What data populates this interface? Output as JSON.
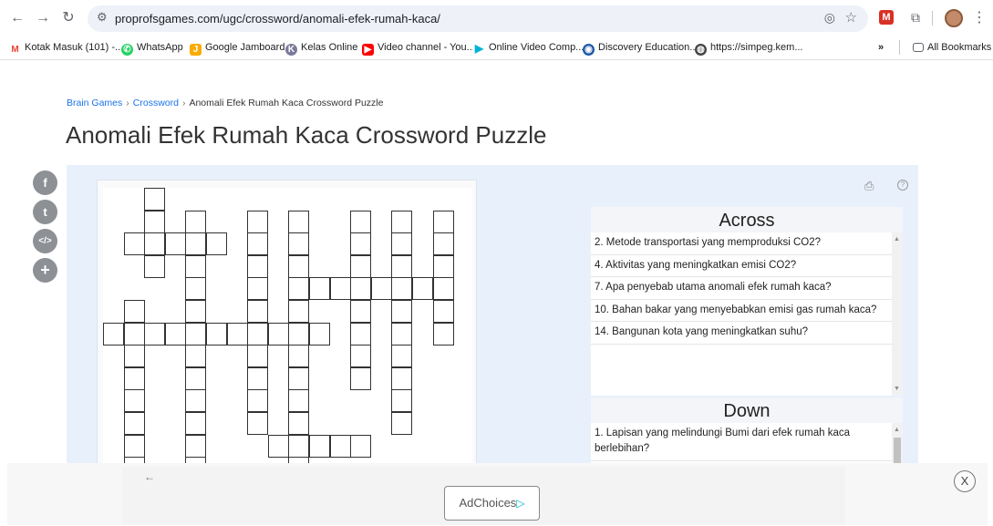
{
  "browser": {
    "url": "proprofsgames.com/ugc/crossword/anomali-efek-rumah-kaca/",
    "back_icon": "arrow-left-icon",
    "forward_icon": "arrow-right-icon",
    "reload_icon": "reload-icon"
  },
  "bookmarks": [
    {
      "label": "Kotak Masuk (101) -...",
      "icon": "gmail-icon",
      "color": "#ea4335"
    },
    {
      "label": "WhatsApp",
      "icon": "whatsapp-icon",
      "color": "#25d366"
    },
    {
      "label": "Google Jamboard",
      "icon": "jamboard-icon",
      "color": "#f9ab00"
    },
    {
      "label": "Kelas Online",
      "icon": "kelas-icon",
      "color": "#7a7a9a"
    },
    {
      "label": "Video channel - You...",
      "icon": "youtube-icon",
      "color": "#ff0000"
    },
    {
      "label": "Online Video Comp...",
      "icon": "play-icon",
      "color": "#00b2d6"
    },
    {
      "label": "Discovery Education...",
      "icon": "globe-icon",
      "color": "#1e5aa8"
    },
    {
      "label": "https://simpeg.kem...",
      "icon": "web-icon",
      "color": "#444444"
    }
  ],
  "bookmarks_more": "»",
  "bookmarks_all": "All Bookmarks",
  "breadcrumb": {
    "home": "Brain Games",
    "section": "Crossword",
    "current": "Anomali Efek Rumah Kaca Crossword Puzzle",
    "separator": "›"
  },
  "page_title": "Anomali Efek Rumah Kaca Crossword Puzzle",
  "share": {
    "facebook": "f",
    "twitter": "t",
    "embed": "</>",
    "more": "+"
  },
  "across": {
    "header": "Across",
    "clues": [
      "2. Metode transportasi yang memproduksi CO2?",
      "4. Aktivitas yang meningkatkan emisi CO2?",
      "7. Apa penyebab utama anomali efek rumah kaca?",
      "10. Bahan bakar yang menyebabkan emisi gas rumah kaca?",
      "14. Bangunan kota yang meningkatkan suhu?"
    ]
  },
  "down": {
    "header": "Down",
    "clues": [
      "1. Lapisan yang melindungi Bumi dari efek rumah kaca berlebihan?"
    ]
  },
  "ad": {
    "label": "AdChoices",
    "close": "X",
    "back": "←"
  }
}
